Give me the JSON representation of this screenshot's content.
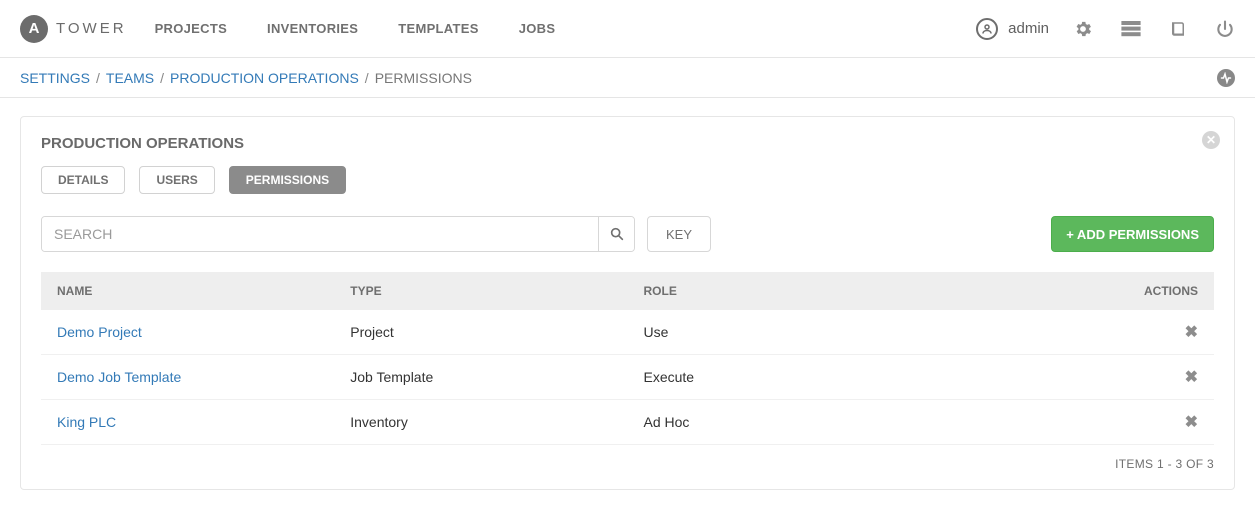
{
  "brand": {
    "initial": "A",
    "name": "TOWER"
  },
  "nav": {
    "projects": "PROJECTS",
    "inventories": "INVENTORIES",
    "templates": "TEMPLATES",
    "jobs": "JOBS"
  },
  "user": {
    "name": "admin"
  },
  "breadcrumbs": {
    "settings": "SETTINGS",
    "teams": "TEAMS",
    "team_name": "PRODUCTION OPERATIONS",
    "current": "PERMISSIONS"
  },
  "panel": {
    "title": "PRODUCTION OPERATIONS",
    "tabs": {
      "details": "DETAILS",
      "users": "USERS",
      "permissions": "PERMISSIONS"
    }
  },
  "toolbar": {
    "search_placeholder": "SEARCH",
    "key_label": "KEY",
    "add_label": "+ ADD PERMISSIONS"
  },
  "table": {
    "columns": {
      "name": "NAME",
      "type": "TYPE",
      "role": "ROLE",
      "actions": "ACTIONS"
    },
    "rows": [
      {
        "name": "Demo Project",
        "type": "Project",
        "role": "Use"
      },
      {
        "name": "Demo Job Template",
        "type": "Job Template",
        "role": "Execute"
      },
      {
        "name": "King PLC",
        "type": "Inventory",
        "role": "Ad Hoc"
      }
    ],
    "pager": "ITEMS  1 - 3 OF 3"
  }
}
